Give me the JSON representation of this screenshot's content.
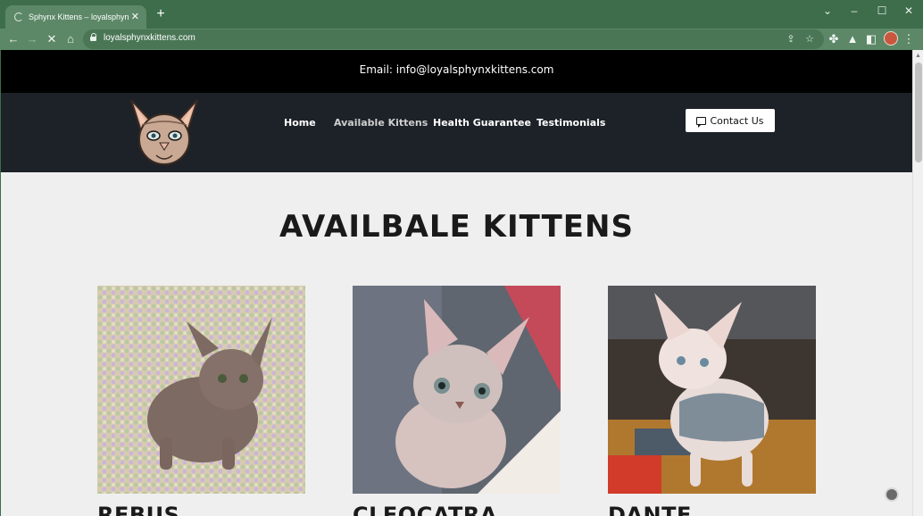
{
  "browser": {
    "tab_title": "Sphynx Kittens – loyalsphynxkitte",
    "url": "loyalsphynxkittens.com"
  },
  "site": {
    "email_line": "Email: info@loyalsphynxkittens.com",
    "nav": {
      "home": "Home",
      "available": "Available Kittens",
      "health": "Health Guarantee",
      "testimonials": "Testimonials"
    },
    "contact_label": "Contact Us",
    "heading": "AVAILBALE KITTENS",
    "kittens": [
      {
        "name": "REBUS"
      },
      {
        "name": "CLEOCATRA"
      },
      {
        "name": "DANTE"
      }
    ]
  },
  "colors": {
    "chrome_frame": "#3e6d4c",
    "chrome_toolbar": "#5c8867",
    "topbar": "#000000",
    "navbar": "#1d2228",
    "page_bg": "#efefef"
  }
}
